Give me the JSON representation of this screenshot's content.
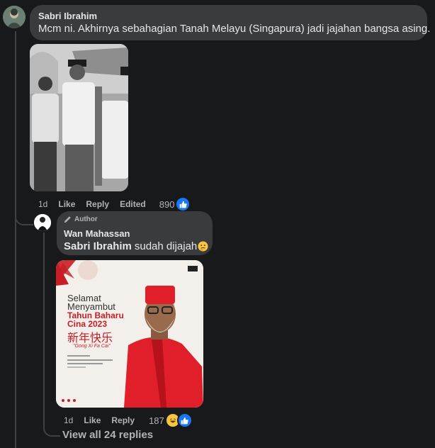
{
  "comment": {
    "author": "Sabri Ibrahim",
    "text": "Mcm ni. Akhirnya sebahagian Tanah Melayu (Singapura) jadi jajahan bangsa asing.",
    "time": "1d",
    "like_label": "Like",
    "reply_label": "Reply",
    "edited_label": "Edited",
    "reaction_count": "890"
  },
  "reply": {
    "badge": "Author",
    "author": "Wan Mahassan",
    "mention": "Sabri Ibrahim",
    "text": "sudah dijajah",
    "time": "1d",
    "like_label": "Like",
    "reply_label": "Reply",
    "reaction_count": "187"
  },
  "poster": {
    "line1": "Selamat",
    "line2": "Menyambut",
    "line3": "Tahun Baharu",
    "line4": "Cina 2023",
    "chinese": "新年快乐",
    "greeting": "\"Gong Xi Fa Cai\"",
    "accent_color": "#c81d25"
  },
  "view_replies": "View all 24 replies"
}
